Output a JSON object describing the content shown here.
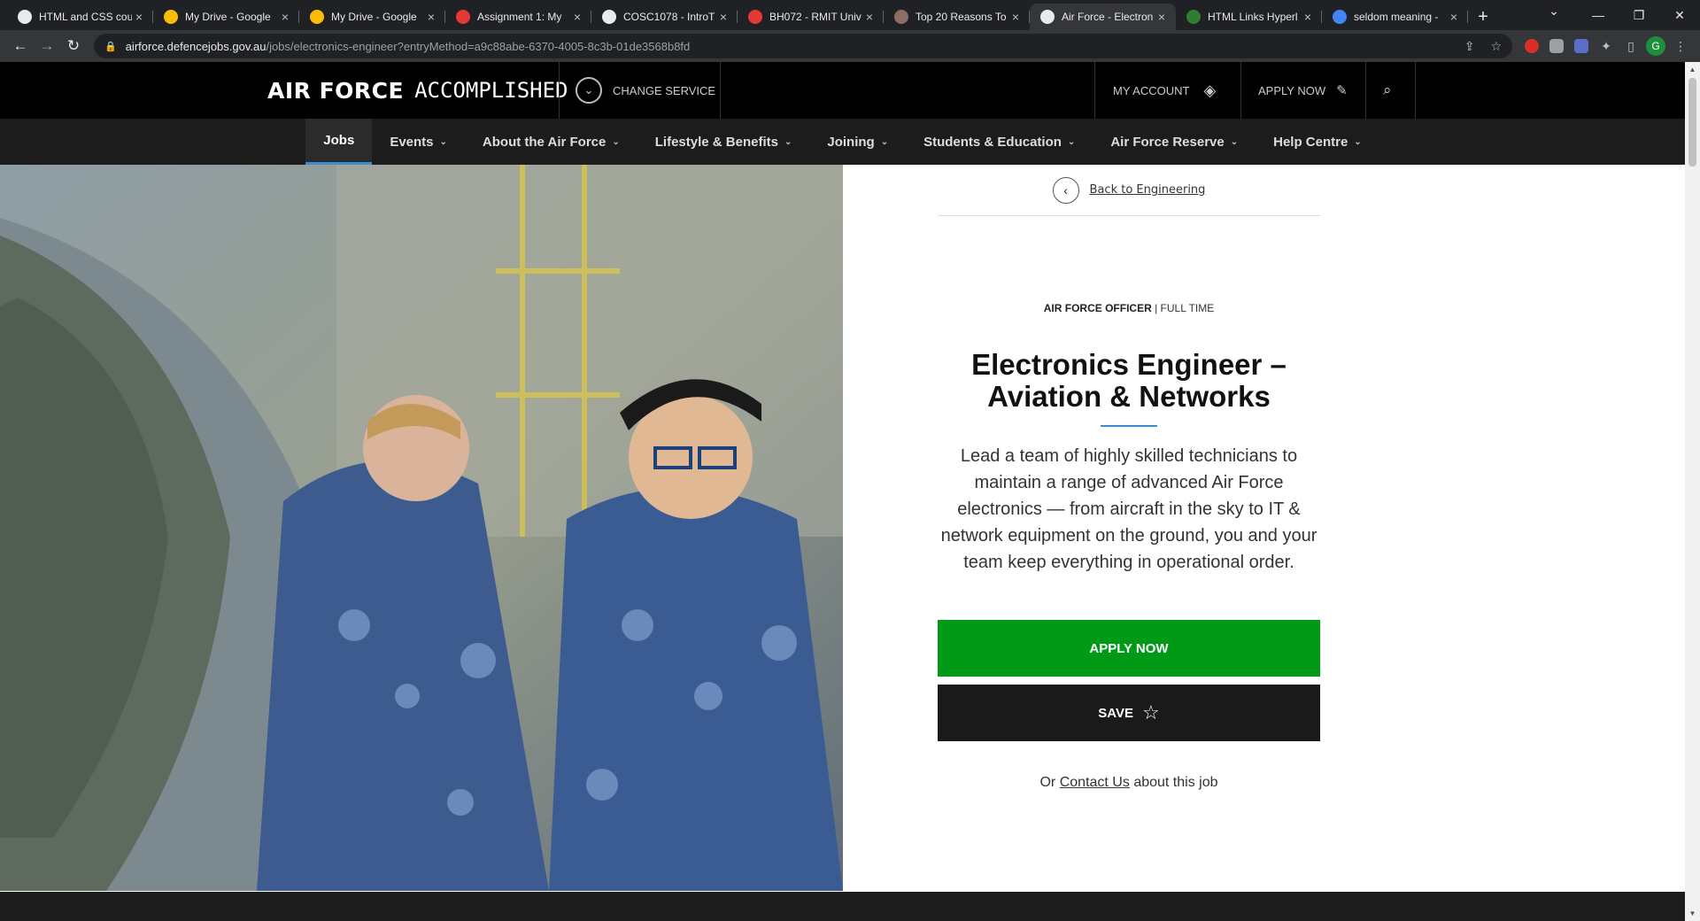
{
  "browser": {
    "tabs": [
      {
        "title": "HTML and CSS cou",
        "color": "#e8eaed"
      },
      {
        "title": "My Drive - Google",
        "color": "#fbbc04"
      },
      {
        "title": "My Drive - Google",
        "color": "#fbbc04"
      },
      {
        "title": "Assignment 1: My",
        "color": "#e53935"
      },
      {
        "title": "COSC1078 - IntroT",
        "color": "#e8eaed"
      },
      {
        "title": "BH072 - RMIT Univ",
        "color": "#e53935"
      },
      {
        "title": "Top 20 Reasons To",
        "color": "#8d6e63"
      },
      {
        "title": "Air Force - Electron",
        "color": "#e8eaed"
      },
      {
        "title": "HTML Links Hyperl",
        "color": "#2e7d32"
      },
      {
        "title": "seldom meaning -",
        "color": "#4285f4"
      }
    ],
    "active_tab_index": 7,
    "url_host": "airforce.defencejobs.gov.au",
    "url_path": "/jobs/electronics-engineer?entryMethod=a9c88abe-6370-4005-8c3b-01de3568b8fd",
    "profile_initial": "G"
  },
  "header": {
    "logo_bold": "AIR FORCE",
    "logo_light": "ACCOMPLISHED",
    "change_service": "CHANGE SERVICE",
    "my_account": "MY ACCOUNT",
    "apply_now": "APPLY NOW"
  },
  "nav": {
    "items": [
      {
        "label": "Jobs",
        "dropdown": false
      },
      {
        "label": "Events",
        "dropdown": true
      },
      {
        "label": "About the Air Force",
        "dropdown": true
      },
      {
        "label": "Lifestyle & Benefits",
        "dropdown": true
      },
      {
        "label": "Joining",
        "dropdown": true
      },
      {
        "label": "Students & Education",
        "dropdown": true
      },
      {
        "label": "Air Force Reserve",
        "dropdown": true
      },
      {
        "label": "Help Centre",
        "dropdown": true
      }
    ]
  },
  "job": {
    "back_label": "Back to Engineering",
    "category": "AIR FORCE OFFICER",
    "employment": "FULL TIME",
    "title": "Electronics Engineer – Aviation & Networks",
    "description": "Lead a team of highly skilled technicians to maintain a range of advanced Air Force electronics — from aircraft in the sky to IT & network equipment on the ground, you and your team keep everything in operational order.",
    "apply_label": "APPLY NOW",
    "save_label": "SAVE",
    "contact_prefix": "Or",
    "contact_link": "Contact Us",
    "contact_suffix": "about this job"
  },
  "colors": {
    "apply_green": "#009a17",
    "nav_accent": "#3d8bd1",
    "save_dark": "#1a1a1a"
  }
}
